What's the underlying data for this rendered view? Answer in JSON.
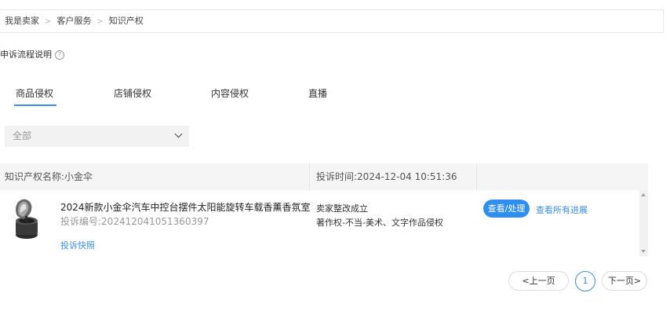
{
  "breadcrumb": {
    "items": [
      "我是卖家",
      "客户服务",
      "知识产权"
    ],
    "separator": ">"
  },
  "appeal_flow": {
    "label": "申诉流程说明",
    "help_icon": "question-circle-icon"
  },
  "tabs": [
    {
      "label": "商品侵权",
      "active": true
    },
    {
      "label": "店铺侵权",
      "active": false
    },
    {
      "label": "内容侵权",
      "active": false
    },
    {
      "label": "直播",
      "active": false
    }
  ],
  "filter": {
    "selected": "全部",
    "icon": "chevron-down-icon"
  },
  "complaint": {
    "ip_name_label": "知识产权名称:小金伞",
    "time_label": "投诉时间:2024-12-04 10:51:36",
    "product_title": "2024新款小金伞汽车中控台摆件太阳能旋转车载香薰香氛室内",
    "complaint_no": "投诉编号:202412041051360397",
    "snapshot_link": "投诉快照",
    "status": "卖家整改成立",
    "reason": "著作权-不当-美术、文字作品侵权",
    "view_button": "查看/处理",
    "progress_link": "查看所有进展"
  },
  "pagination": {
    "prev": "<上一页",
    "current_page": "1",
    "next": "下一页>"
  },
  "colors": {
    "accent": "#2f8ff0",
    "link": "#3a8ee6",
    "header_bg": "#f5f5f5",
    "select_bg": "#f2f2f2"
  }
}
